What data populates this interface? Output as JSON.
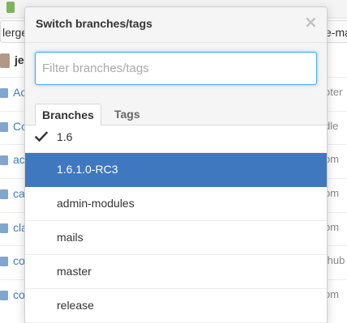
{
  "background": {
    "tab_left": "lerge",
    "tab_right": "e-ma",
    "user_name": "je",
    "rows": [
      {
        "name": "Ac",
        "msg": "oter"
      },
      {
        "name": "Co",
        "msg": "dle"
      },
      {
        "name": "ac",
        "msg": "om"
      },
      {
        "name": "ca",
        "msg": "om"
      },
      {
        "name": "cla",
        "msg": "om"
      },
      {
        "name": "co",
        "msg": "thub"
      },
      {
        "name": "co",
        "msg": "om"
      }
    ]
  },
  "dropdown": {
    "title": "Switch branches/tags",
    "close_glyph": "×",
    "filter": {
      "placeholder": "Filter branches/tags",
      "value": ""
    },
    "tabs": [
      {
        "label": "Branches",
        "active": true
      },
      {
        "label": "Tags",
        "active": false
      }
    ],
    "branches": [
      {
        "label": "1.6",
        "current": true,
        "selected": false
      },
      {
        "label": "1.6.1.0-RC3",
        "current": false,
        "selected": true
      },
      {
        "label": "admin-modules",
        "current": false,
        "selected": false
      },
      {
        "label": "mails",
        "current": false,
        "selected": false
      },
      {
        "label": "master",
        "current": false,
        "selected": false
      },
      {
        "label": "release",
        "current": false,
        "selected": false
      }
    ]
  },
  "colors": {
    "accent": "#4078c0",
    "focus_border": "#51a7e8",
    "link": "#4183c4"
  },
  "icons": {
    "close": "close-icon",
    "check": "check-icon",
    "folder": "folder-icon"
  }
}
